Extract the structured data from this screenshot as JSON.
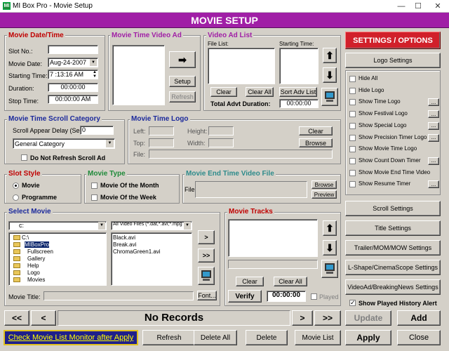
{
  "window": {
    "app_icon": "MI",
    "title": "MI Box Pro - Movie Setup",
    "min": "—",
    "max": "☐",
    "close": "✕"
  },
  "header": {
    "title": "MOVIE SETUP"
  },
  "date_time": {
    "title": "Movie Date/Time",
    "slot_label": "Slot No.:",
    "slot_value": "",
    "date_label": "Movie Date:",
    "date_value": "Aug-24-2007",
    "start_label": "Starting Time:",
    "start_value": "7 :13:16 AM",
    "duration_label": "Duration:",
    "duration_value": "00:00:00",
    "stop_label": "Stop Time:",
    "stop_value": "00:00:00 AM"
  },
  "video_ad": {
    "title": "Movie Time Video Ad",
    "arrow": "➡",
    "setup": "Setup",
    "refresh": "Refresh"
  },
  "ad_list": {
    "title": "Video Ad List",
    "file_list": "File List:",
    "starting_time": "Starting Time:",
    "clear": "Clear",
    "clear_all": "Clear All",
    "sort": "Sort Adv List",
    "total_label": "Total Advt Duration:",
    "total_value": "00:00:00",
    "up": "⬆",
    "down": "⬇"
  },
  "settings": {
    "title": "SETTINGS / OPTIONS",
    "logo_settings": "Logo Settings",
    "options": [
      {
        "label": "Hide All",
        "dots": false
      },
      {
        "label": "Hide Logo",
        "dots": false
      },
      {
        "label": "Show Time Logo",
        "dots": true
      },
      {
        "label": "Show Festival Logo",
        "dots": true
      },
      {
        "label": "Show Special Logo",
        "dots": true
      },
      {
        "label": "Show Precision Timer Logo",
        "dots": true
      },
      {
        "label": "Show Movie Time Logo",
        "dots": false
      },
      {
        "label": "Show Count Down Timer",
        "dots": true
      },
      {
        "label": "Show Movie End Time Video",
        "dots": false
      },
      {
        "label": "Show Resume Timer",
        "dots": true
      }
    ],
    "dots_label": "...",
    "scroll": "Scroll Settings",
    "title_settings": "Title Settings",
    "trailer": "Trailer/MOM/MOW Settings",
    "lshape": "L-Shape/CinemaScope Settings",
    "videoad": "VideoAd/BreakingNews Settings",
    "show_played": "Show Played History Alert"
  },
  "scroll_cat": {
    "title": "Movie Time Scroll Category",
    "delay_label": "Scroll Appear Delay (Sec):",
    "delay_value": "0",
    "category": "General Category",
    "no_refresh": "Do Not Refresh Scroll Ad"
  },
  "time_logo": {
    "title": "Movie Time Logo",
    "left": "Left:",
    "top": "Top:",
    "height": "Height:",
    "width": "Width:",
    "file": "File:",
    "clear": "Clear",
    "browse": "Browse"
  },
  "slot_style": {
    "title": "Slot Style",
    "movie": "Movie",
    "programme": "Programme"
  },
  "movie_type": {
    "title": "Movie Type",
    "month": "Movie Of the Month",
    "week": "Movie Of the Week"
  },
  "end_video": {
    "title": "Movie End Time Video File",
    "file": "File:",
    "browse": "Browse",
    "preview": "Preview"
  },
  "select_movie": {
    "title": "Select Movie",
    "drive": "c:",
    "filter": "All Video Files (*.dat,*.avi;*.mpg",
    "tree": [
      "C:\\",
      "MIBoxPro",
      "Fullscreen",
      "Gallery",
      "Help",
      "Logo",
      "Movies"
    ],
    "files": [
      "Black.avi",
      "Break.avi",
      "ChromaGreen1.avi"
    ],
    "add": ">",
    "add_all": ">>",
    "title_label": "Movie Title:",
    "font": "Font..."
  },
  "tracks": {
    "title": "Movie Tracks",
    "clear": "Clear",
    "clear_all": "Clear All",
    "verify": "Verify",
    "time": "00:00:00",
    "played": "Played"
  },
  "nav": {
    "first": "<<",
    "prev": "<",
    "records": "No Records",
    "next": ">",
    "last": ">>",
    "update": "Update",
    "add": "Add"
  },
  "bottom": {
    "link": "Check Movie List Monitor after Apply",
    "refresh": "Refresh",
    "delete_all": "Delete All",
    "delete": "Delete",
    "movie_list": "Movie List",
    "apply": "Apply",
    "close": "Close"
  }
}
